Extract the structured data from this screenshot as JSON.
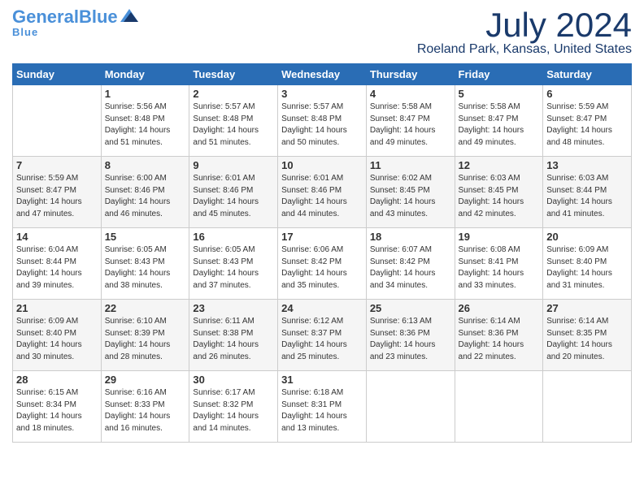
{
  "header": {
    "logo_general": "General",
    "logo_blue": "Blue",
    "month_title": "July 2024",
    "location": "Roeland Park, Kansas, United States"
  },
  "weekdays": [
    "Sunday",
    "Monday",
    "Tuesday",
    "Wednesday",
    "Thursday",
    "Friday",
    "Saturday"
  ],
  "weeks": [
    [
      {
        "day": "",
        "sunrise": "",
        "sunset": "",
        "daylight": ""
      },
      {
        "day": "1",
        "sunrise": "Sunrise: 5:56 AM",
        "sunset": "Sunset: 8:48 PM",
        "daylight": "Daylight: 14 hours and 51 minutes."
      },
      {
        "day": "2",
        "sunrise": "Sunrise: 5:57 AM",
        "sunset": "Sunset: 8:48 PM",
        "daylight": "Daylight: 14 hours and 51 minutes."
      },
      {
        "day": "3",
        "sunrise": "Sunrise: 5:57 AM",
        "sunset": "Sunset: 8:48 PM",
        "daylight": "Daylight: 14 hours and 50 minutes."
      },
      {
        "day": "4",
        "sunrise": "Sunrise: 5:58 AM",
        "sunset": "Sunset: 8:47 PM",
        "daylight": "Daylight: 14 hours and 49 minutes."
      },
      {
        "day": "5",
        "sunrise": "Sunrise: 5:58 AM",
        "sunset": "Sunset: 8:47 PM",
        "daylight": "Daylight: 14 hours and 49 minutes."
      },
      {
        "day": "6",
        "sunrise": "Sunrise: 5:59 AM",
        "sunset": "Sunset: 8:47 PM",
        "daylight": "Daylight: 14 hours and 48 minutes."
      }
    ],
    [
      {
        "day": "7",
        "sunrise": "Sunrise: 5:59 AM",
        "sunset": "Sunset: 8:47 PM",
        "daylight": "Daylight: 14 hours and 47 minutes."
      },
      {
        "day": "8",
        "sunrise": "Sunrise: 6:00 AM",
        "sunset": "Sunset: 8:46 PM",
        "daylight": "Daylight: 14 hours and 46 minutes."
      },
      {
        "day": "9",
        "sunrise": "Sunrise: 6:01 AM",
        "sunset": "Sunset: 8:46 PM",
        "daylight": "Daylight: 14 hours and 45 minutes."
      },
      {
        "day": "10",
        "sunrise": "Sunrise: 6:01 AM",
        "sunset": "Sunset: 8:46 PM",
        "daylight": "Daylight: 14 hours and 44 minutes."
      },
      {
        "day": "11",
        "sunrise": "Sunrise: 6:02 AM",
        "sunset": "Sunset: 8:45 PM",
        "daylight": "Daylight: 14 hours and 43 minutes."
      },
      {
        "day": "12",
        "sunrise": "Sunrise: 6:03 AM",
        "sunset": "Sunset: 8:45 PM",
        "daylight": "Daylight: 14 hours and 42 minutes."
      },
      {
        "day": "13",
        "sunrise": "Sunrise: 6:03 AM",
        "sunset": "Sunset: 8:44 PM",
        "daylight": "Daylight: 14 hours and 41 minutes."
      }
    ],
    [
      {
        "day": "14",
        "sunrise": "Sunrise: 6:04 AM",
        "sunset": "Sunset: 8:44 PM",
        "daylight": "Daylight: 14 hours and 39 minutes."
      },
      {
        "day": "15",
        "sunrise": "Sunrise: 6:05 AM",
        "sunset": "Sunset: 8:43 PM",
        "daylight": "Daylight: 14 hours and 38 minutes."
      },
      {
        "day": "16",
        "sunrise": "Sunrise: 6:05 AM",
        "sunset": "Sunset: 8:43 PM",
        "daylight": "Daylight: 14 hours and 37 minutes."
      },
      {
        "day": "17",
        "sunrise": "Sunrise: 6:06 AM",
        "sunset": "Sunset: 8:42 PM",
        "daylight": "Daylight: 14 hours and 35 minutes."
      },
      {
        "day": "18",
        "sunrise": "Sunrise: 6:07 AM",
        "sunset": "Sunset: 8:42 PM",
        "daylight": "Daylight: 14 hours and 34 minutes."
      },
      {
        "day": "19",
        "sunrise": "Sunrise: 6:08 AM",
        "sunset": "Sunset: 8:41 PM",
        "daylight": "Daylight: 14 hours and 33 minutes."
      },
      {
        "day": "20",
        "sunrise": "Sunrise: 6:09 AM",
        "sunset": "Sunset: 8:40 PM",
        "daylight": "Daylight: 14 hours and 31 minutes."
      }
    ],
    [
      {
        "day": "21",
        "sunrise": "Sunrise: 6:09 AM",
        "sunset": "Sunset: 8:40 PM",
        "daylight": "Daylight: 14 hours and 30 minutes."
      },
      {
        "day": "22",
        "sunrise": "Sunrise: 6:10 AM",
        "sunset": "Sunset: 8:39 PM",
        "daylight": "Daylight: 14 hours and 28 minutes."
      },
      {
        "day": "23",
        "sunrise": "Sunrise: 6:11 AM",
        "sunset": "Sunset: 8:38 PM",
        "daylight": "Daylight: 14 hours and 26 minutes."
      },
      {
        "day": "24",
        "sunrise": "Sunrise: 6:12 AM",
        "sunset": "Sunset: 8:37 PM",
        "daylight": "Daylight: 14 hours and 25 minutes."
      },
      {
        "day": "25",
        "sunrise": "Sunrise: 6:13 AM",
        "sunset": "Sunset: 8:36 PM",
        "daylight": "Daylight: 14 hours and 23 minutes."
      },
      {
        "day": "26",
        "sunrise": "Sunrise: 6:14 AM",
        "sunset": "Sunset: 8:36 PM",
        "daylight": "Daylight: 14 hours and 22 minutes."
      },
      {
        "day": "27",
        "sunrise": "Sunrise: 6:14 AM",
        "sunset": "Sunset: 8:35 PM",
        "daylight": "Daylight: 14 hours and 20 minutes."
      }
    ],
    [
      {
        "day": "28",
        "sunrise": "Sunrise: 6:15 AM",
        "sunset": "Sunset: 8:34 PM",
        "daylight": "Daylight: 14 hours and 18 minutes."
      },
      {
        "day": "29",
        "sunrise": "Sunrise: 6:16 AM",
        "sunset": "Sunset: 8:33 PM",
        "daylight": "Daylight: 14 hours and 16 minutes."
      },
      {
        "day": "30",
        "sunrise": "Sunrise: 6:17 AM",
        "sunset": "Sunset: 8:32 PM",
        "daylight": "Daylight: 14 hours and 14 minutes."
      },
      {
        "day": "31",
        "sunrise": "Sunrise: 6:18 AM",
        "sunset": "Sunset: 8:31 PM",
        "daylight": "Daylight: 14 hours and 13 minutes."
      },
      {
        "day": "",
        "sunrise": "",
        "sunset": "",
        "daylight": ""
      },
      {
        "day": "",
        "sunrise": "",
        "sunset": "",
        "daylight": ""
      },
      {
        "day": "",
        "sunrise": "",
        "sunset": "",
        "daylight": ""
      }
    ]
  ]
}
